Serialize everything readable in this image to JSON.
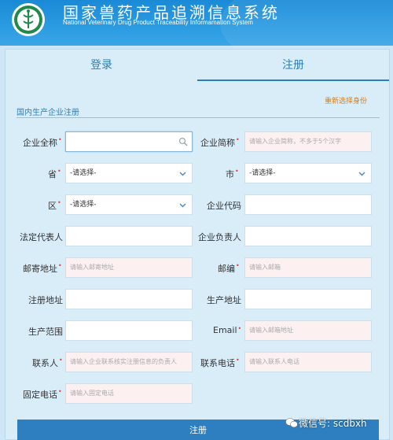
{
  "header": {
    "title_cn": "国家兽药产品追溯信息系统",
    "title_en": "National Veterinary Drug Product Traceability Informamation System"
  },
  "tabs": [
    {
      "label": "登录"
    },
    {
      "label": "注册"
    }
  ],
  "reselect_label": "重新选择身份",
  "section_title": "国内生产企业注册",
  "form": {
    "company_full_name": {
      "label": "企业全称",
      "value": "",
      "placeholder": ""
    },
    "company_short_name": {
      "label": "企业简称",
      "placeholder": "请输入企业简称，不多于5个汉字"
    },
    "province": {
      "label": "省",
      "value": "-请选择-"
    },
    "city": {
      "label": "市",
      "value": "-请选择-"
    },
    "district": {
      "label": "区",
      "value": "-请选择-"
    },
    "company_code": {
      "label": "企业代码",
      "placeholder": ""
    },
    "legal_rep": {
      "label": "法定代表人",
      "placeholder": ""
    },
    "company_head": {
      "label": "企业负责人",
      "placeholder": ""
    },
    "mail_address": {
      "label": "邮寄地址",
      "placeholder": "请输入邮寄地址"
    },
    "postcode": {
      "label": "邮编",
      "placeholder": "请输入邮箱"
    },
    "reg_address": {
      "label": "注册地址",
      "placeholder": ""
    },
    "prod_address": {
      "label": "生产地址",
      "placeholder": ""
    },
    "prod_scope": {
      "label": "生产范围",
      "placeholder": ""
    },
    "email": {
      "label": "Email",
      "placeholder": "请输入邮箱地址"
    },
    "contact": {
      "label": "联系人",
      "placeholder": "请输入企业联系核实注册信息的负责人"
    },
    "contact_phone": {
      "label": "联系电话",
      "placeholder": "请输入联系人电话"
    },
    "landline": {
      "label": "固定电话",
      "placeholder": "请输入固定电话"
    }
  },
  "submit_label": "注册",
  "watermark": "微信号: scdbxh",
  "required_mark": "•"
}
